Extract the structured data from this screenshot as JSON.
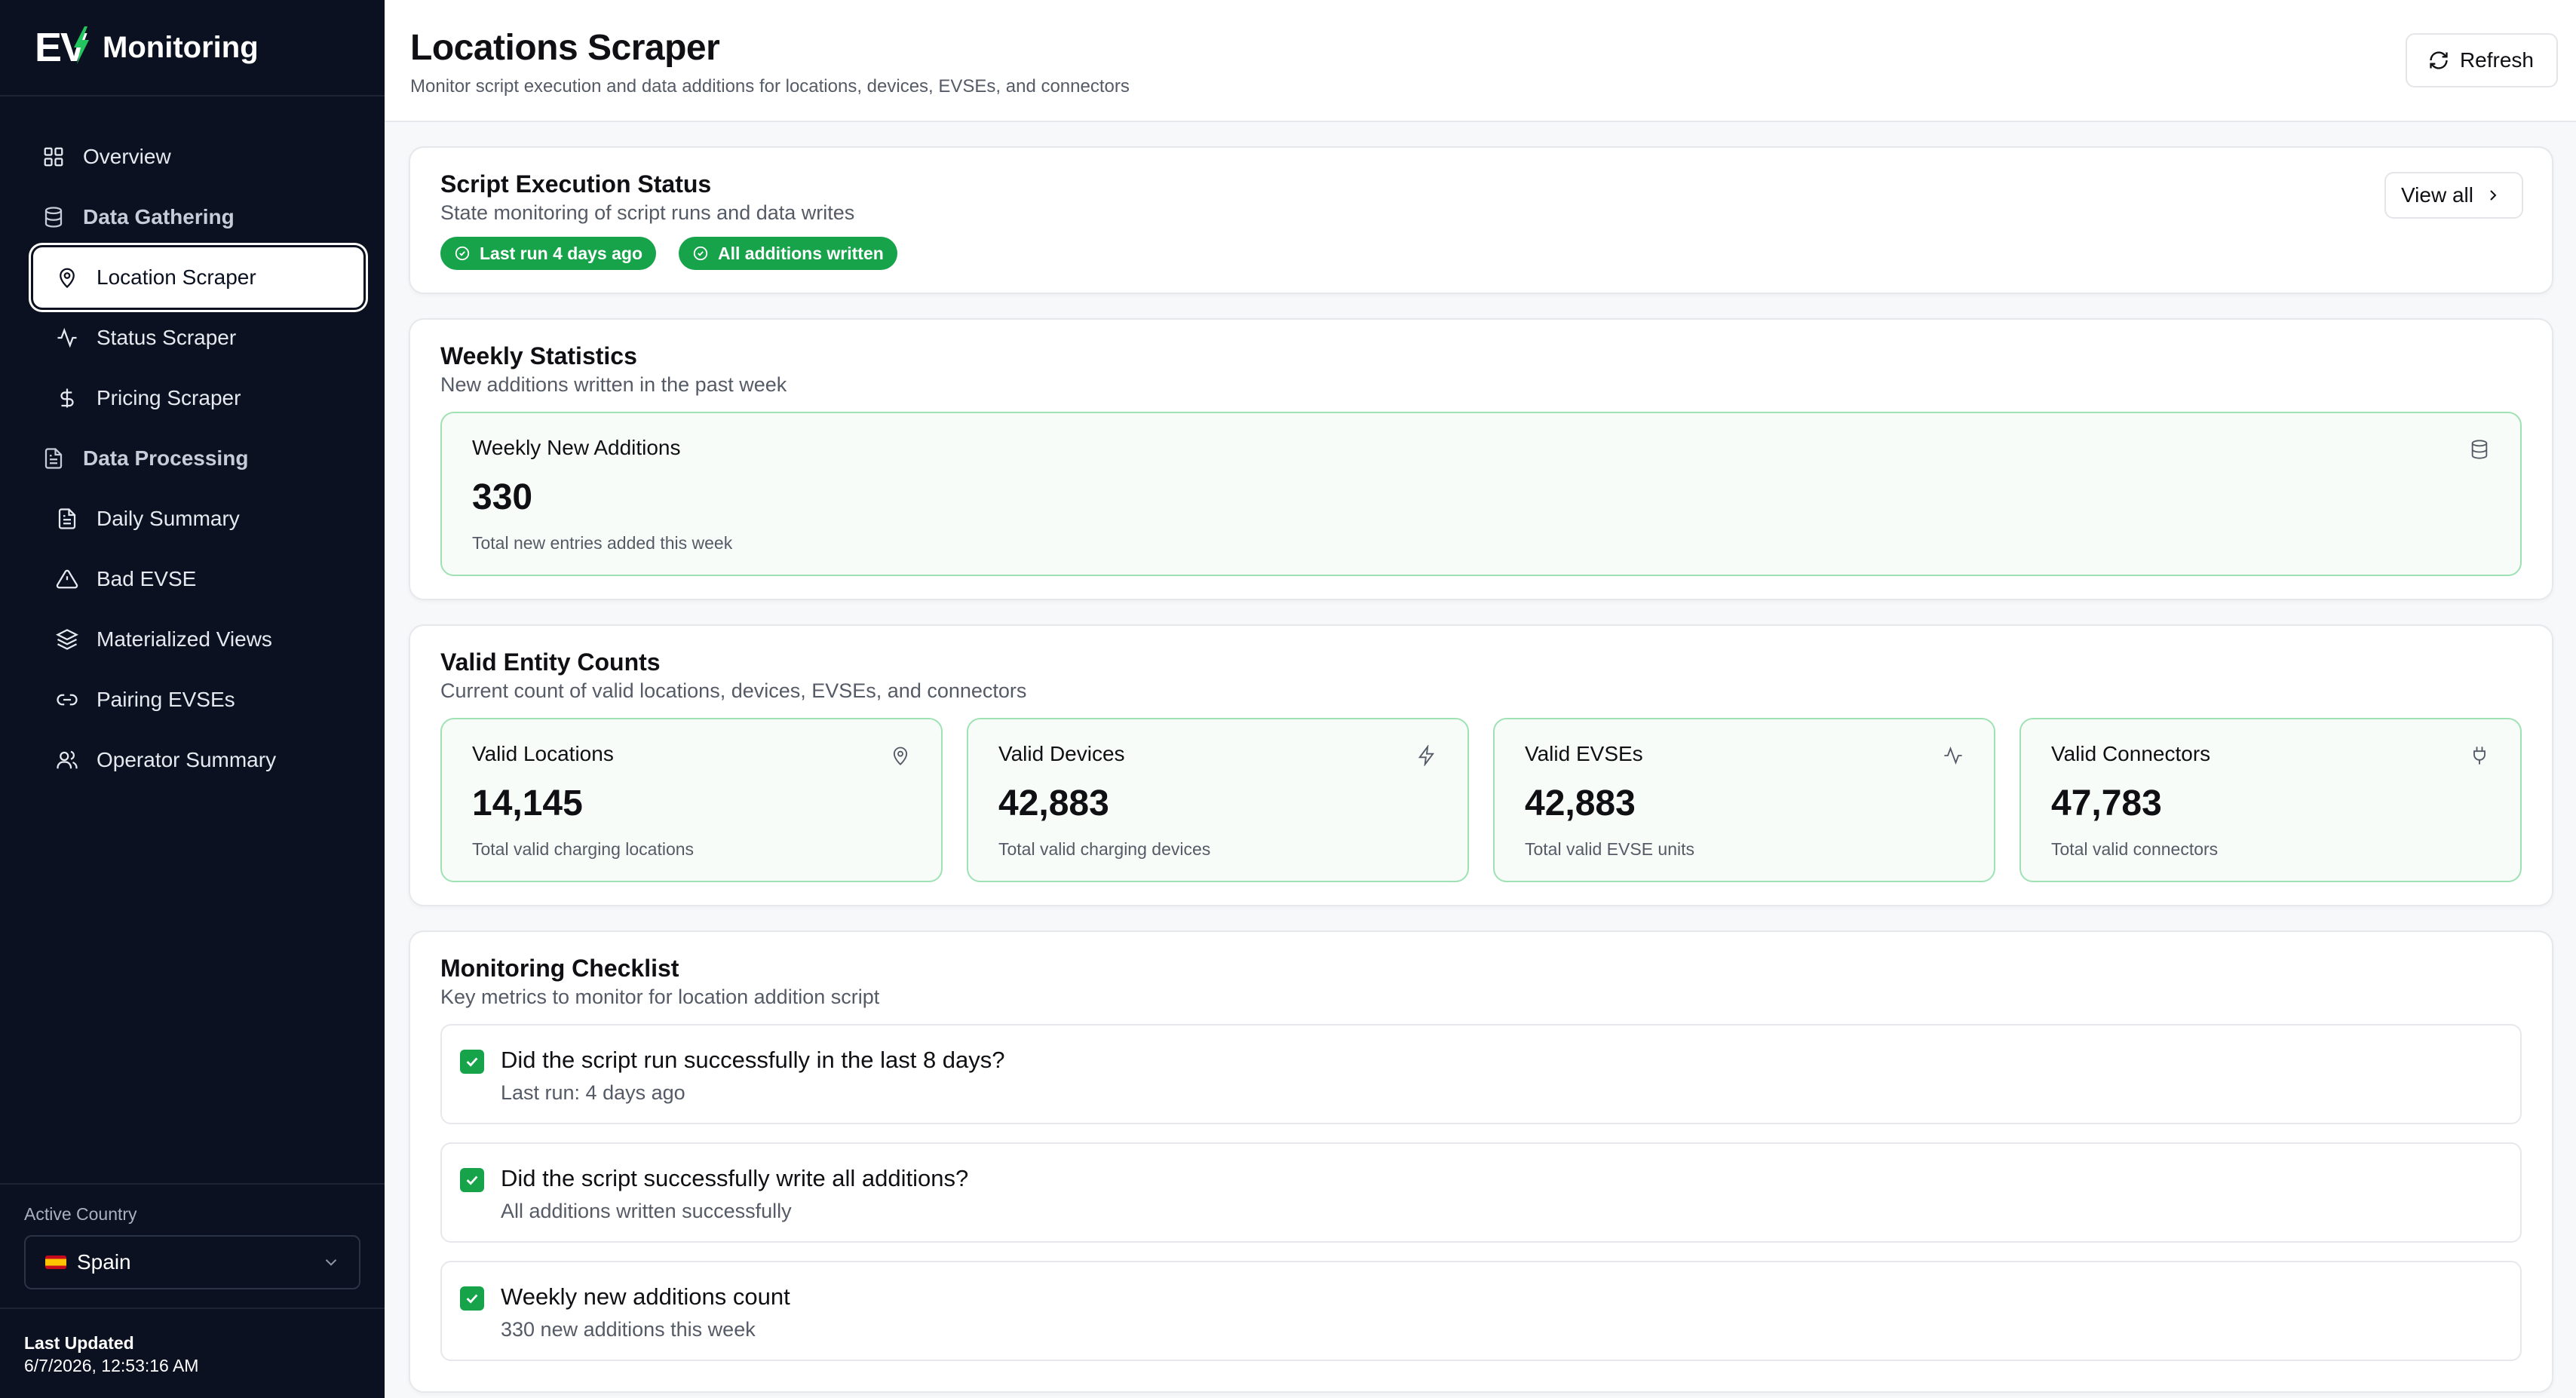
{
  "brand": {
    "logo_text": "EV",
    "name": "Monitoring"
  },
  "nav": {
    "overview": "Overview",
    "data_gathering": "Data Gathering",
    "location_scraper": "Location Scraper",
    "status_scraper": "Status Scraper",
    "pricing_scraper": "Pricing Scraper",
    "data_processing": "Data Processing",
    "daily_summary": "Daily Summary",
    "bad_evse": "Bad EVSE",
    "materialized_views": "Materialized Views",
    "pairing_evses": "Pairing EVSEs",
    "operator_summary": "Operator Summary",
    "active_item": "Location Scraper"
  },
  "country": {
    "label": "Active Country",
    "value": "Spain"
  },
  "updated": {
    "label": "Last Updated",
    "value": "6/7/2026, 12:53:16 AM"
  },
  "header": {
    "title": "Locations Scraper",
    "subtitle": "Monitor script execution and data additions for locations, devices, EVSEs, and connectors",
    "refresh_label": "Refresh"
  },
  "execution": {
    "title": "Script Execution Status",
    "subtitle": "State monitoring of script runs and data writes",
    "badge_last_run": "Last run 4 days ago",
    "badge_additions": "All additions written",
    "view_all_label": "View all"
  },
  "weekly": {
    "title": "Weekly Statistics",
    "subtitle": "New additions written in the past week",
    "stat_title": "Weekly New Additions",
    "stat_value": "330",
    "stat_desc": "Total new entries added this week"
  },
  "entities": {
    "title": "Valid Entity Counts",
    "subtitle": "Current count of valid locations, devices, EVSEs, and connectors",
    "items": [
      {
        "title": "Valid Locations",
        "value": "14,145",
        "desc": "Total valid charging locations",
        "icon": "map-pin-icon"
      },
      {
        "title": "Valid Devices",
        "value": "42,883",
        "desc": "Total valid charging devices",
        "icon": "lightning-icon"
      },
      {
        "title": "Valid EVSEs",
        "value": "42,883",
        "desc": "Total valid EVSE units",
        "icon": "activity-icon"
      },
      {
        "title": "Valid Connectors",
        "value": "47,783",
        "desc": "Total valid connectors",
        "icon": "plug-icon"
      }
    ]
  },
  "checklist": {
    "title": "Monitoring Checklist",
    "subtitle": "Key metrics to monitor for location addition script",
    "items": [
      {
        "question": "Did the script run successfully in the last 8 days?",
        "answer": "Last run: 4 days ago",
        "checked": true
      },
      {
        "question": "Did the script successfully write all additions?",
        "answer": "All additions written successfully",
        "checked": true
      },
      {
        "question": "Weekly new additions count",
        "answer": "330 new additions this week",
        "checked": true
      }
    ]
  },
  "colors": {
    "sidebar_bg": "#0b1120",
    "accent_green": "#16a34a",
    "stat_border": "#9ee2b4",
    "stat_bg": "#f7fcf8"
  }
}
